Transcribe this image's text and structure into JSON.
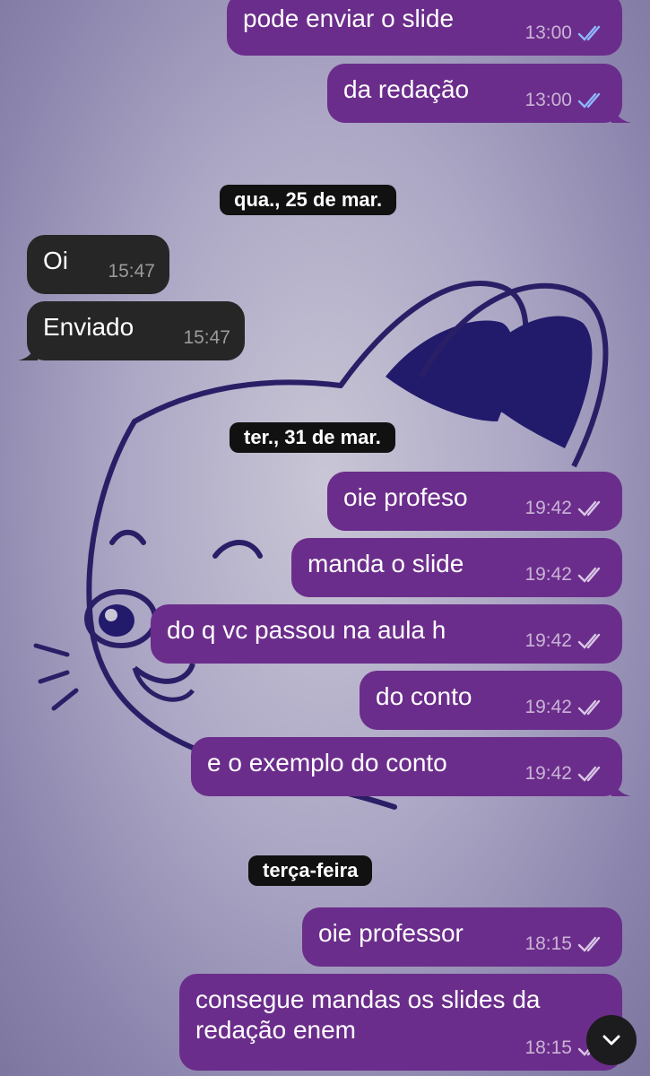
{
  "colors": {
    "outgoing_bubble": "#6b2d8b",
    "incoming_bubble": "#262626",
    "read_ticks": "#8fb7ff",
    "sent_ticks": "#d9c7e6",
    "date_pill": "#111111"
  },
  "messages_top": [
    {
      "text": "pode enviar o slide",
      "time": "13:00",
      "status": "read"
    },
    {
      "text": "da redação",
      "time": "13:00",
      "status": "read"
    }
  ],
  "date_1": "qua., 25 de mar.",
  "incoming": [
    {
      "text": "Oi",
      "time": "15:47"
    },
    {
      "text": "Enviado",
      "time": "15:47"
    }
  ],
  "date_2": "ter., 31 de mar.",
  "messages_mid": [
    {
      "text": "oie profeso",
      "time": "19:42",
      "status": "delivered"
    },
    {
      "text": "manda o slide",
      "time": "19:42",
      "status": "delivered"
    },
    {
      "text": "do q vc passou na aula h",
      "time": "19:42",
      "status": "delivered"
    },
    {
      "text": "do conto",
      "time": "19:42",
      "status": "delivered"
    },
    {
      "text": "e o exemplo do conto",
      "time": "19:42",
      "status": "delivered"
    }
  ],
  "date_3": "terça-feira",
  "messages_bottom": [
    {
      "text": "oie professor",
      "time": "18:15",
      "status": "delivered"
    },
    {
      "line1": "consegue mandas os slides da",
      "line2": "redação enem",
      "time": "18:15",
      "status": "delivered"
    }
  ],
  "scroll_button_icon": "chevron-down-icon",
  "wallpaper_icon": "bunny-illustration"
}
